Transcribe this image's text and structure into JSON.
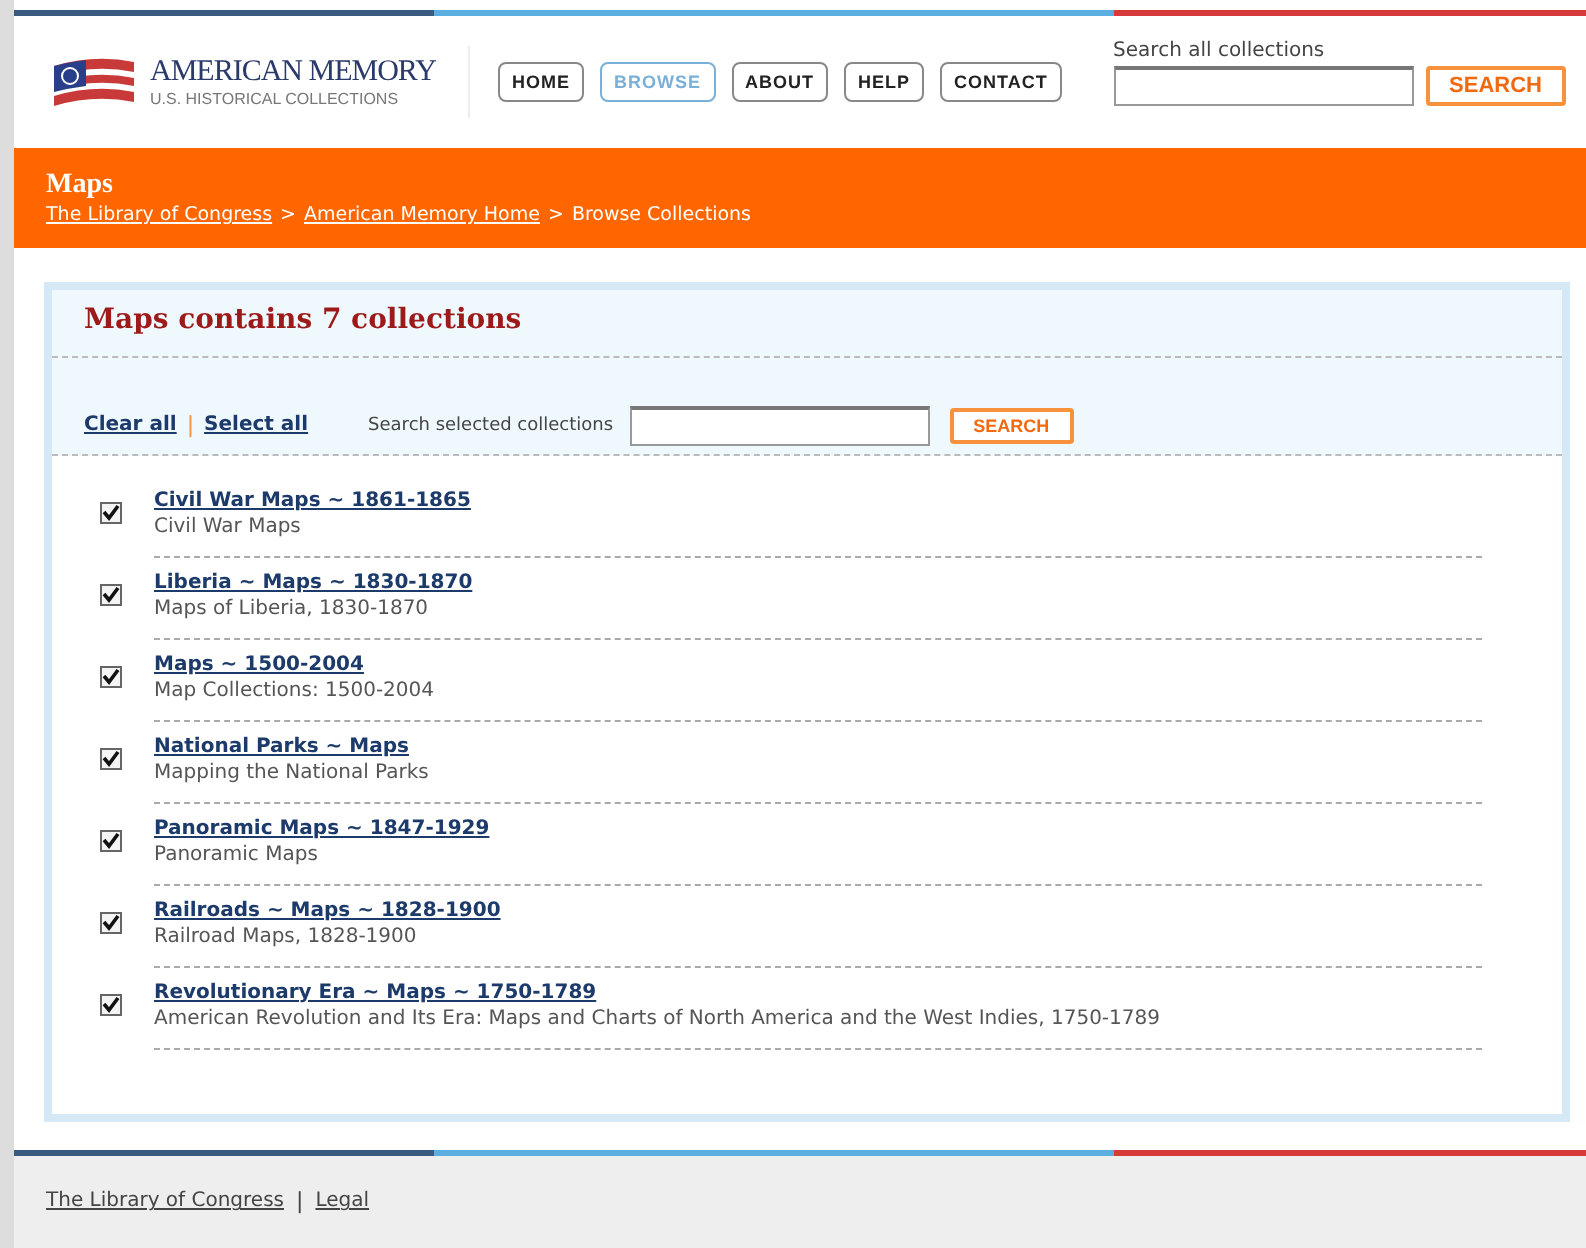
{
  "header": {
    "logo_title": "AMERICAN MEMORY",
    "logo_subtitle": "U.S. HISTORICAL COLLECTIONS",
    "nav": [
      {
        "label": "HOME",
        "selected": false
      },
      {
        "label": "BROWSE",
        "selected": true
      },
      {
        "label": "ABOUT",
        "selected": false
      },
      {
        "label": "HELP",
        "selected": false
      },
      {
        "label": "CONTACT",
        "selected": false
      }
    ],
    "search_label": "Search all collections",
    "search_button": "SEARCH"
  },
  "banner": {
    "title": "Maps",
    "breadcrumb": [
      {
        "label": "The Library of Congress",
        "link": true
      },
      {
        "label": "American Memory Home",
        "link": true
      },
      {
        "label": "Browse Collections",
        "link": false
      }
    ],
    "separator": ">"
  },
  "panel": {
    "heading": "Maps contains 7 collections",
    "clear_all": "Clear all",
    "select_all": "Select all",
    "links_separator": "|",
    "search_label": "Search selected collections",
    "search_button": "SEARCH",
    "collections": [
      {
        "title": "Civil War Maps ~ 1861-1865",
        "description": "Civil War Maps",
        "checked": true
      },
      {
        "title": "Liberia ~ Maps ~ 1830-1870",
        "description": "Maps of Liberia, 1830-1870",
        "checked": true
      },
      {
        "title": "Maps ~ 1500-2004",
        "description": "Map Collections: 1500-2004",
        "checked": true
      },
      {
        "title": "National Parks ~ Maps",
        "description": "Mapping the National Parks",
        "checked": true
      },
      {
        "title": "Panoramic Maps ~ 1847-1929",
        "description": "Panoramic Maps",
        "checked": true
      },
      {
        "title": "Railroads ~ Maps ~ 1828-1900",
        "description": "Railroad Maps, 1828-1900",
        "checked": true
      },
      {
        "title": "Revolutionary Era ~ Maps ~ 1750-1789",
        "description": "American Revolution and Its Era: Maps and Charts of North America and the West Indies, 1750-1789",
        "checked": true
      }
    ]
  },
  "footer": {
    "links": [
      "The Library of Congress",
      "Legal"
    ],
    "separator": "|"
  }
}
